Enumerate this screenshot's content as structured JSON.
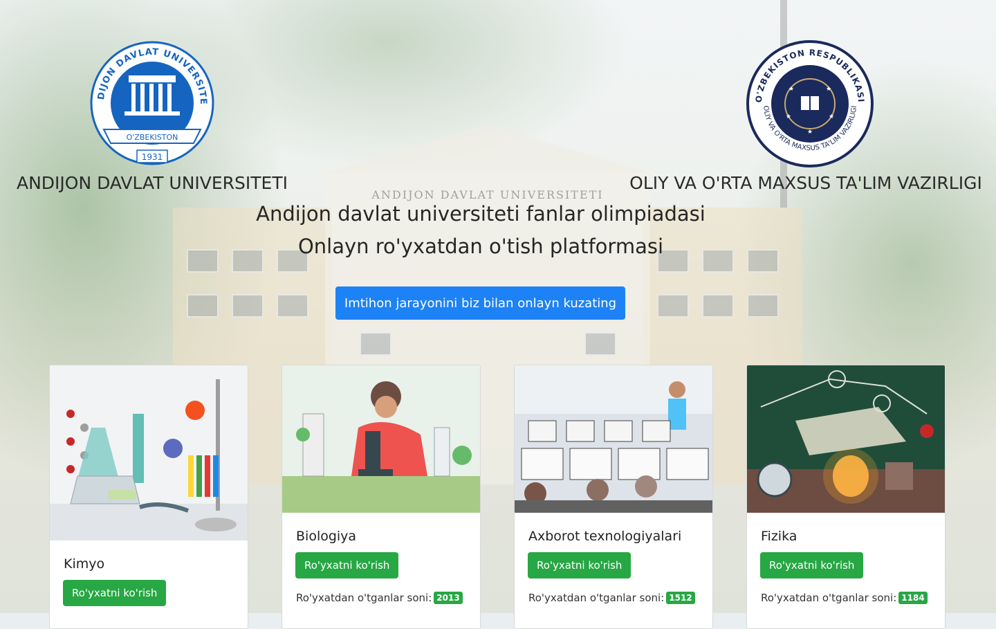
{
  "header": {
    "university_name": "ANDIJON DAVLAT UNIVERSITETI",
    "ministry_name": "OLIY VA O'RTA MAXSUS TA'LIM VAZIRLIGI",
    "university_logo": {
      "top_text": "ANDIJON DAVLAT UNIVERSITETI",
      "ribbon_text": "O'ZBEKISTON",
      "year": "1931"
    },
    "ministry_logo": {
      "top_text": "O'ZBEKISTON RESPUBLIKASI",
      "bottom_text": "OLIY VA O'RTA MAXSUS TA'LIM VAZIRLIGI"
    }
  },
  "background": {
    "building_sign": "ANDIJON DAVLAT UNIVERSITETI"
  },
  "hero": {
    "title_line1": "Andijon davlat universiteti fanlar olimpiadasi",
    "title_line2": "Onlayn ro'yxatdan o'tish platformasi",
    "watch_button": "Imtihon jarayonini biz bilan onlayn kuzating"
  },
  "subjects": [
    {
      "name": "Kimyo",
      "button": "Ro'yxatni ko'rish",
      "count_label": "",
      "count": ""
    },
    {
      "name": "Biologiya",
      "button": "Ro'yxatni ko'rish",
      "count_label": "Ro'yxatdan o'tganlar soni:",
      "count": "2013"
    },
    {
      "name": "Axborot texnologiyalari",
      "button": "Ro'yxatni ko'rish",
      "count_label": "Ro'yxatdan o'tganlar soni:",
      "count": "1512"
    },
    {
      "name": "Fizika",
      "button": "Ro'yxatni ko'rish",
      "count_label": "Ro'yxatdan o'tganlar soni:",
      "count": "1184"
    }
  ],
  "colors": {
    "primary": "#1d82f5",
    "success": "#28a745",
    "logo_blue": "#1565c0",
    "ministry_navy": "#1b2a5c"
  }
}
